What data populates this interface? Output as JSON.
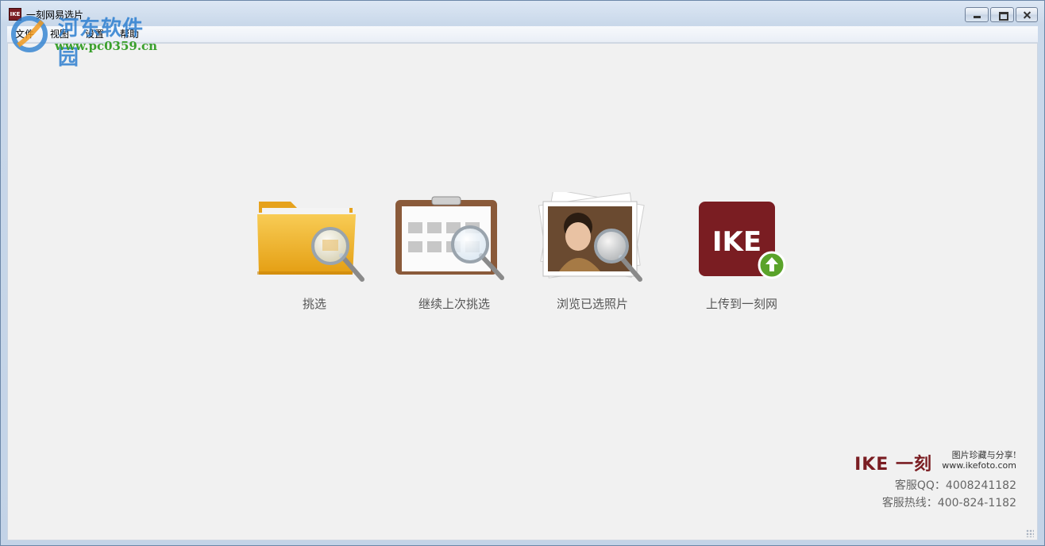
{
  "window": {
    "title": "一刻网易选片",
    "icon_text": "IKE"
  },
  "menu": [
    {
      "label": "文件"
    },
    {
      "label": "视图"
    },
    {
      "label": "设置"
    },
    {
      "label": "帮助"
    }
  ],
  "watermark": {
    "name": "河东软件园",
    "url": "www.pc0359.cn"
  },
  "actions": [
    {
      "label": "挑选",
      "icon": "folder-magnifier-icon"
    },
    {
      "label": "继续上次挑选",
      "icon": "clipboard-photos-icon"
    },
    {
      "label": "浏览已选照片",
      "icon": "photo-stack-icon"
    },
    {
      "label": "上传到一刻网",
      "icon": "ike-upload-icon"
    }
  ],
  "ike_icon_text": "IKE",
  "brand": {
    "logo": "IKE 一刻",
    "slogan": "图片珍藏与分享!",
    "url": "www.ikefoto.com",
    "qq": "客服QQ：4008241182",
    "hotline": "客服热线：400-824-1182"
  },
  "colors": {
    "brand_red": "#7a1d22",
    "upload_green": "#5aa32a",
    "folder_yellow": "#f3b62c"
  }
}
